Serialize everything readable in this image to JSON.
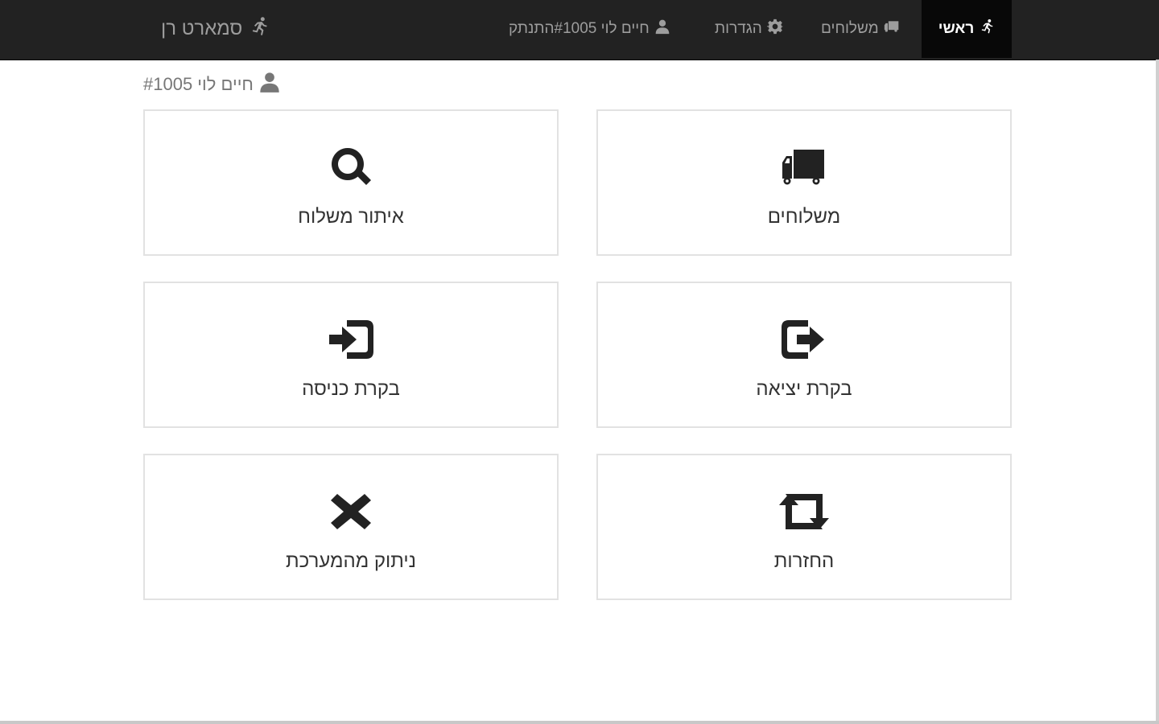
{
  "navbar": {
    "brand": {
      "label": "סמארט רן",
      "icon": "runner-icon"
    },
    "items": [
      {
        "label": "ראשי",
        "icon": "runner-icon",
        "active": true
      },
      {
        "label": "משלוחים",
        "icon": "truck-icon"
      },
      {
        "label": "הגדרות",
        "icon": "gear-icon"
      },
      {
        "label": "חיים לוי #1005התנתק",
        "icon": "user-icon"
      }
    ]
  },
  "user_line": {
    "label": "חיים לוי #1005",
    "icon": "user-icon"
  },
  "tiles": [
    {
      "label": "משלוחים",
      "icon": "truck-icon"
    },
    {
      "label": "איתור משלוח",
      "icon": "search-icon"
    },
    {
      "label": "בקרת יציאה",
      "icon": "log-out-icon"
    },
    {
      "label": "בקרת כניסה",
      "icon": "log-in-icon"
    },
    {
      "label": "החזרות",
      "icon": "retweet-icon"
    },
    {
      "label": "ניתוק מהמערכת",
      "icon": "remove-icon"
    }
  ],
  "colors": {
    "navbar_bg": "#222222",
    "navbar_active_bg": "#080808",
    "nav_text": "#9d9d9d",
    "tile_border": "#e2e2e2",
    "icon": "#222222"
  }
}
